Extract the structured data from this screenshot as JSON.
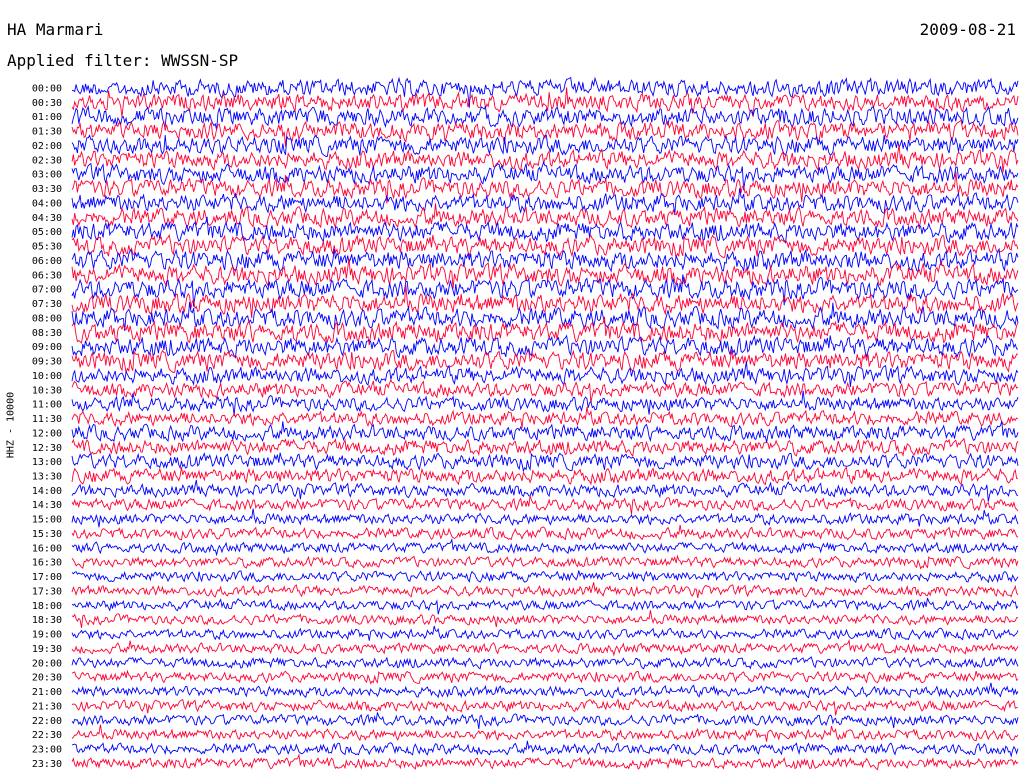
{
  "header": {
    "station": "HA Marmari",
    "date": "2009-08-21",
    "filter": "Applied filter: WWSSN-SP",
    "channel": "HHZ - 10000"
  },
  "chart_data": {
    "type": "line",
    "title": "HA Marmari",
    "date": "2009-08-21",
    "filter": "WWSSN-SP",
    "ylabel": "HHZ - 10000",
    "row_labels": [
      "00:00",
      "00:30",
      "01:00",
      "01:30",
      "02:00",
      "02:30",
      "03:00",
      "03:30",
      "04:00",
      "04:30",
      "05:00",
      "05:30",
      "06:00",
      "06:30",
      "07:00",
      "07:30",
      "08:00",
      "08:30",
      "09:00",
      "09:30",
      "10:00",
      "10:30",
      "11:00",
      "11:30",
      "12:00",
      "12:30",
      "13:00",
      "13:30",
      "14:00",
      "14:30",
      "15:00",
      "15:30",
      "16:00",
      "16:30",
      "17:00",
      "17:30",
      "18:00",
      "18:30",
      "19:00",
      "19:30",
      "20:00",
      "20:30",
      "21:00",
      "21:30",
      "22:00",
      "22:30",
      "23:00",
      "23:30"
    ],
    "row_colors": [
      "#0000ff",
      "#ff0033"
    ],
    "amplitude_level": [
      0.75,
      0.75,
      0.8,
      0.8,
      0.8,
      0.8,
      0.8,
      0.8,
      0.8,
      0.8,
      0.85,
      0.85,
      0.9,
      0.9,
      0.9,
      0.9,
      0.9,
      0.9,
      0.85,
      0.85,
      0.7,
      0.6,
      0.55,
      0.55,
      0.6,
      0.6,
      0.6,
      0.6,
      0.45,
      0.4,
      0.35,
      0.35,
      0.3,
      0.3,
      0.3,
      0.3,
      0.28,
      0.28,
      0.28,
      0.28,
      0.3,
      0.3,
      0.32,
      0.32,
      0.32,
      0.32,
      0.32,
      0.32
    ],
    "grid": false
  }
}
